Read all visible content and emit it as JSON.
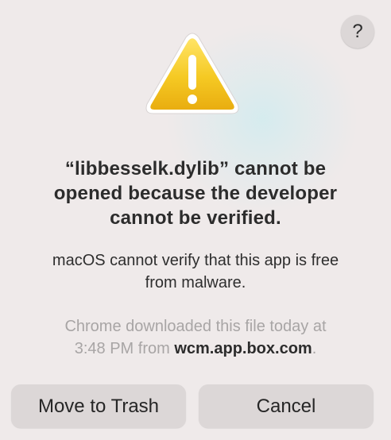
{
  "dialog": {
    "help_label": "?",
    "icon": "warning-triangle-icon",
    "title_line1": "“libbesselk.dylib” cannot be",
    "title_line2": "opened because the developer",
    "title_line3": "cannot be verified.",
    "message_line1": "macOS cannot verify that this app is free",
    "message_line2": "from malware.",
    "source_line1": "Chrome downloaded this file today at",
    "source_line2_prefix": "3:48 PM from ",
    "source_domain": "wcm.app.box.com",
    "source_suffix": ".",
    "buttons": {
      "move_to_trash": "Move to Trash",
      "cancel": "Cancel"
    }
  },
  "colors": {
    "background": "#efeaea",
    "button": "#dcd7d7",
    "warning_yellow": "#f2c21a"
  }
}
